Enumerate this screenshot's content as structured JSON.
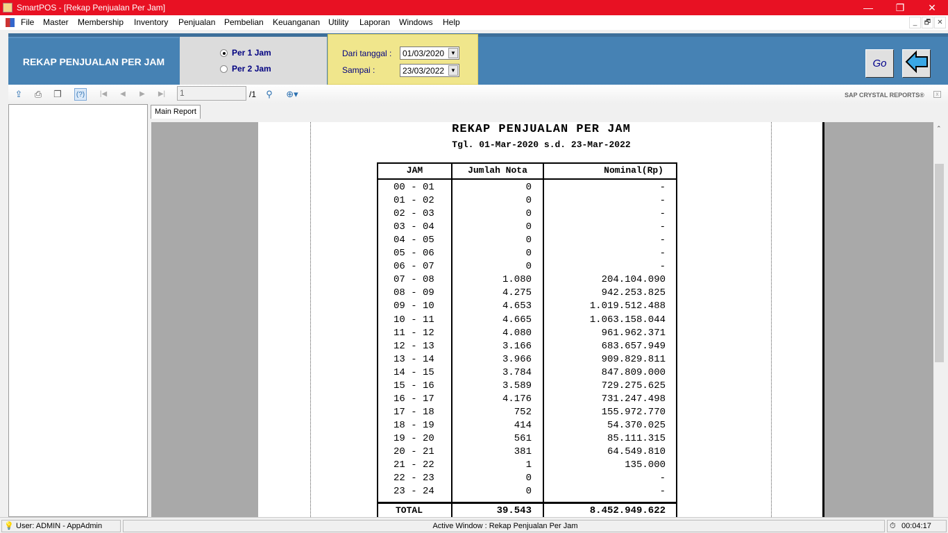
{
  "window": {
    "title": "SmartPOS - [Rekap Penjualan Per Jam]",
    "controls": [
      "—",
      "❐",
      "✕"
    ],
    "mdi_controls": [
      "_",
      "🗗",
      "✕"
    ]
  },
  "menu": [
    "File",
    "Master",
    "Membership",
    "Inventory",
    "Penjualan",
    "Pembelian",
    "Keuanganan",
    "Utility",
    "Laporan",
    "Windows",
    "Help"
  ],
  "form": {
    "title": "REKAP PENJUALAN PER JAM",
    "radio1": "Per 1 Jam",
    "radio2": "Per 2 Jam",
    "selected": "Per 1 Jam",
    "from_label": "Dari tanggal :",
    "from_value": "01/03/2020",
    "to_label": "Sampai  :",
    "to_value": "23/03/2022",
    "go_label": "Go"
  },
  "toolbar": {
    "page_value": "1",
    "page_total": "/1",
    "brand": "SAP CRYSTAL REPORTS®"
  },
  "tab": "Main Report",
  "report": {
    "title": "REKAP PENJUALAN PER JAM",
    "subtitle": "Tgl. 01-Mar-2020 s.d. 23-Mar-2022",
    "headers": [
      "JAM",
      "Jumlah Nota",
      "Nominal(Rp)"
    ],
    "rows": [
      [
        "00 - 01",
        "0",
        "-"
      ],
      [
        "01 - 02",
        "0",
        "-"
      ],
      [
        "02 - 03",
        "0",
        "-"
      ],
      [
        "03 - 04",
        "0",
        "-"
      ],
      [
        "04 - 05",
        "0",
        "-"
      ],
      [
        "05 - 06",
        "0",
        "-"
      ],
      [
        "06 - 07",
        "0",
        "-"
      ],
      [
        "07 - 08",
        "1.080",
        "204.104.090"
      ],
      [
        "08 - 09",
        "4.275",
        "942.253.825"
      ],
      [
        "09 - 10",
        "4.653",
        "1.019.512.488"
      ],
      [
        "10 - 11",
        "4.665",
        "1.063.158.044"
      ],
      [
        "11 - 12",
        "4.080",
        "961.962.371"
      ],
      [
        "12 - 13",
        "3.166",
        "683.657.949"
      ],
      [
        "13 - 14",
        "3.966",
        "909.829.811"
      ],
      [
        "14 - 15",
        "3.784",
        "847.809.000"
      ],
      [
        "15 - 16",
        "3.589",
        "729.275.625"
      ],
      [
        "16 - 17",
        "4.176",
        "731.247.498"
      ],
      [
        "17 - 18",
        "752",
        "155.972.770"
      ],
      [
        "18 - 19",
        "414",
        "54.370.025"
      ],
      [
        "19 - 20",
        "561",
        "85.111.315"
      ],
      [
        "20 - 21",
        "381",
        "64.549.810"
      ],
      [
        "21 - 22",
        "1",
        "135.000"
      ],
      [
        "22 - 23",
        "0",
        "-"
      ],
      [
        "23 - 24",
        "0",
        "-"
      ]
    ],
    "total": [
      "TOTAL",
      "39.543",
      "8.452.949.622"
    ]
  },
  "status": {
    "user": "User: ADMIN - AppAdmin",
    "active": "Active Window : Rekap Penjualan Per Jam",
    "time": "00:04:17"
  }
}
